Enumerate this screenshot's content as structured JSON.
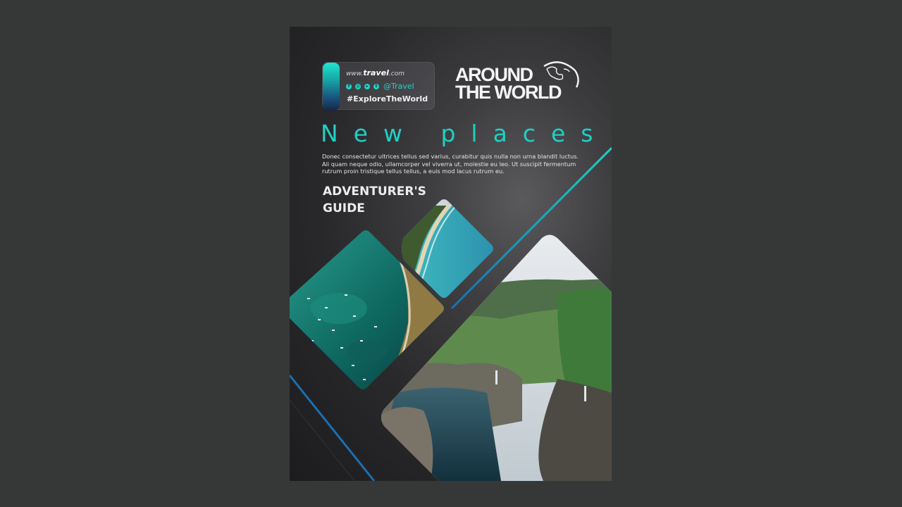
{
  "header": {
    "url_prefix": "www.",
    "url_name": "travel",
    "url_suffix": ".com",
    "social_handle": "@Travel",
    "hashtag": "#ExploreTheWorld",
    "social_icons": [
      "facebook-icon",
      "instagram-icon",
      "youtube-icon",
      "twitter-icon"
    ]
  },
  "logo": {
    "line1": "AROUND",
    "line2": "THE WORLD"
  },
  "headline": "New places",
  "body": "Donec consectetur ultrices tellus sed varius, curabitur quis nulla non urna blandit luctus. Ali quam neque odio, ullamcorper vel viverra ut, molestie eu leo. Ut suscipit fermentum rutrum proin tristique tellus tellus, a euis mod lacus rutrum eu.",
  "guide": {
    "line1": "ADVENTURER'S",
    "line2": "GUIDE"
  },
  "colors": {
    "accent": "#1fd0c4",
    "background": "#363837",
    "flyer_dark": "#1c1c1e"
  }
}
